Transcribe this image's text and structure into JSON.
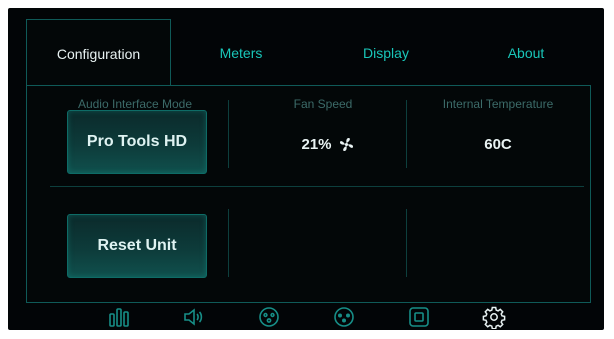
{
  "tabs": [
    {
      "label": "Configuration",
      "active": true
    },
    {
      "label": "Meters",
      "active": false
    },
    {
      "label": "Display",
      "active": false
    },
    {
      "label": "About",
      "active": false
    }
  ],
  "config": {
    "audio_interface_mode": {
      "heading": "Audio Interface Mode",
      "value": "Pro Tools HD"
    },
    "fan_speed": {
      "heading": "Fan Speed",
      "value": "21%"
    },
    "internal_temperature": {
      "heading": "Internal Temperature",
      "value": "60C"
    },
    "reset_label": "Reset Unit"
  },
  "bottom_nav": [
    {
      "icon": "meters-icon"
    },
    {
      "icon": "speaker-icon"
    },
    {
      "icon": "face-plate-icon"
    },
    {
      "icon": "connector-icon"
    },
    {
      "icon": "square-icon"
    },
    {
      "icon": "gear-icon"
    }
  ],
  "colors": {
    "accent": "#19c6b9",
    "border": "#0f5a58",
    "background": "#020507"
  }
}
